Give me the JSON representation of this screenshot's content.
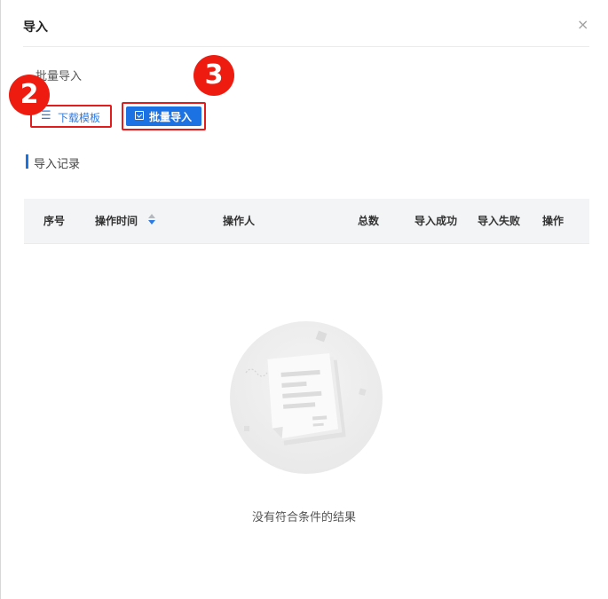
{
  "dialog": {
    "title": "导入",
    "close_icon": "×"
  },
  "batch": {
    "section_label": "批量导入",
    "download_button": "下载模板",
    "import_button": "批量导入"
  },
  "annotations": {
    "badge_2": "2",
    "badge_3": "3",
    "color": "#ee1c10"
  },
  "records": {
    "title": "导入记录",
    "columns": [
      "序号",
      "操作时间",
      "操作人",
      "总数",
      "导入成功",
      "导入失败",
      "操作"
    ],
    "rows": [],
    "empty_text": "没有符合条件的结果"
  },
  "colors": {
    "primary": "#1c72e3",
    "highlight_border": "#e21c1c",
    "header_bg": "#f3f4f6"
  }
}
